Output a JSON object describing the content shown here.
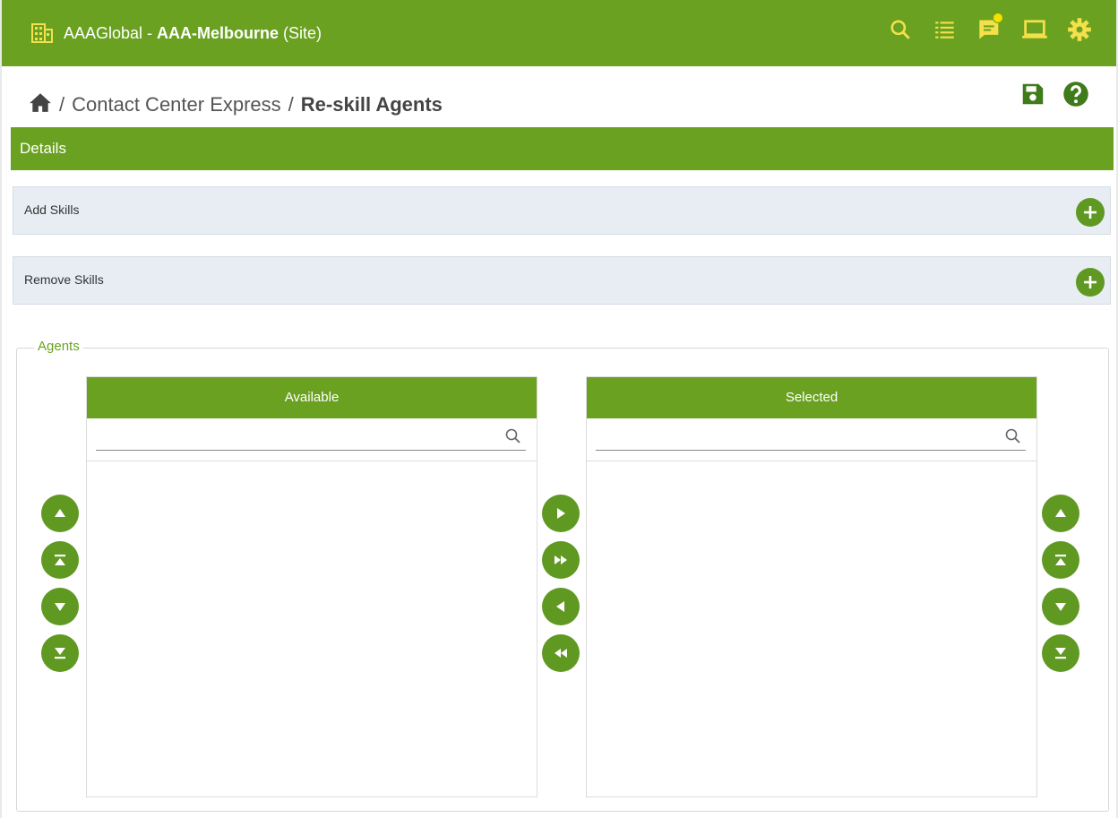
{
  "header": {
    "org": "AAAGlobal - ",
    "site": "AAA-Melbourne",
    "site_suffix": " (Site)"
  },
  "breadcrumb": {
    "sep1": "/",
    "section": "Contact Center Express",
    "sep2": "/",
    "current": "Re-skill Agents"
  },
  "details": {
    "label": "Details"
  },
  "accordions": [
    {
      "label": "Add Skills"
    },
    {
      "label": "Remove Skills"
    }
  ],
  "agents": {
    "legend": "Agents",
    "available": {
      "header": "Available",
      "search_placeholder": "",
      "items": []
    },
    "selected": {
      "header": "Selected",
      "search_placeholder": "",
      "items": []
    }
  },
  "colors": {
    "brand": "#6aa121",
    "button": "#5f9922",
    "accordion_bg": "#e8edf4",
    "badge": "#f5e100"
  },
  "icons": {
    "topbar": [
      "building-icon",
      "search-icon",
      "list-icon",
      "chat-icon",
      "laptop-icon",
      "gear-icon"
    ],
    "header": [
      "home-icon",
      "save-icon",
      "help-icon"
    ]
  }
}
